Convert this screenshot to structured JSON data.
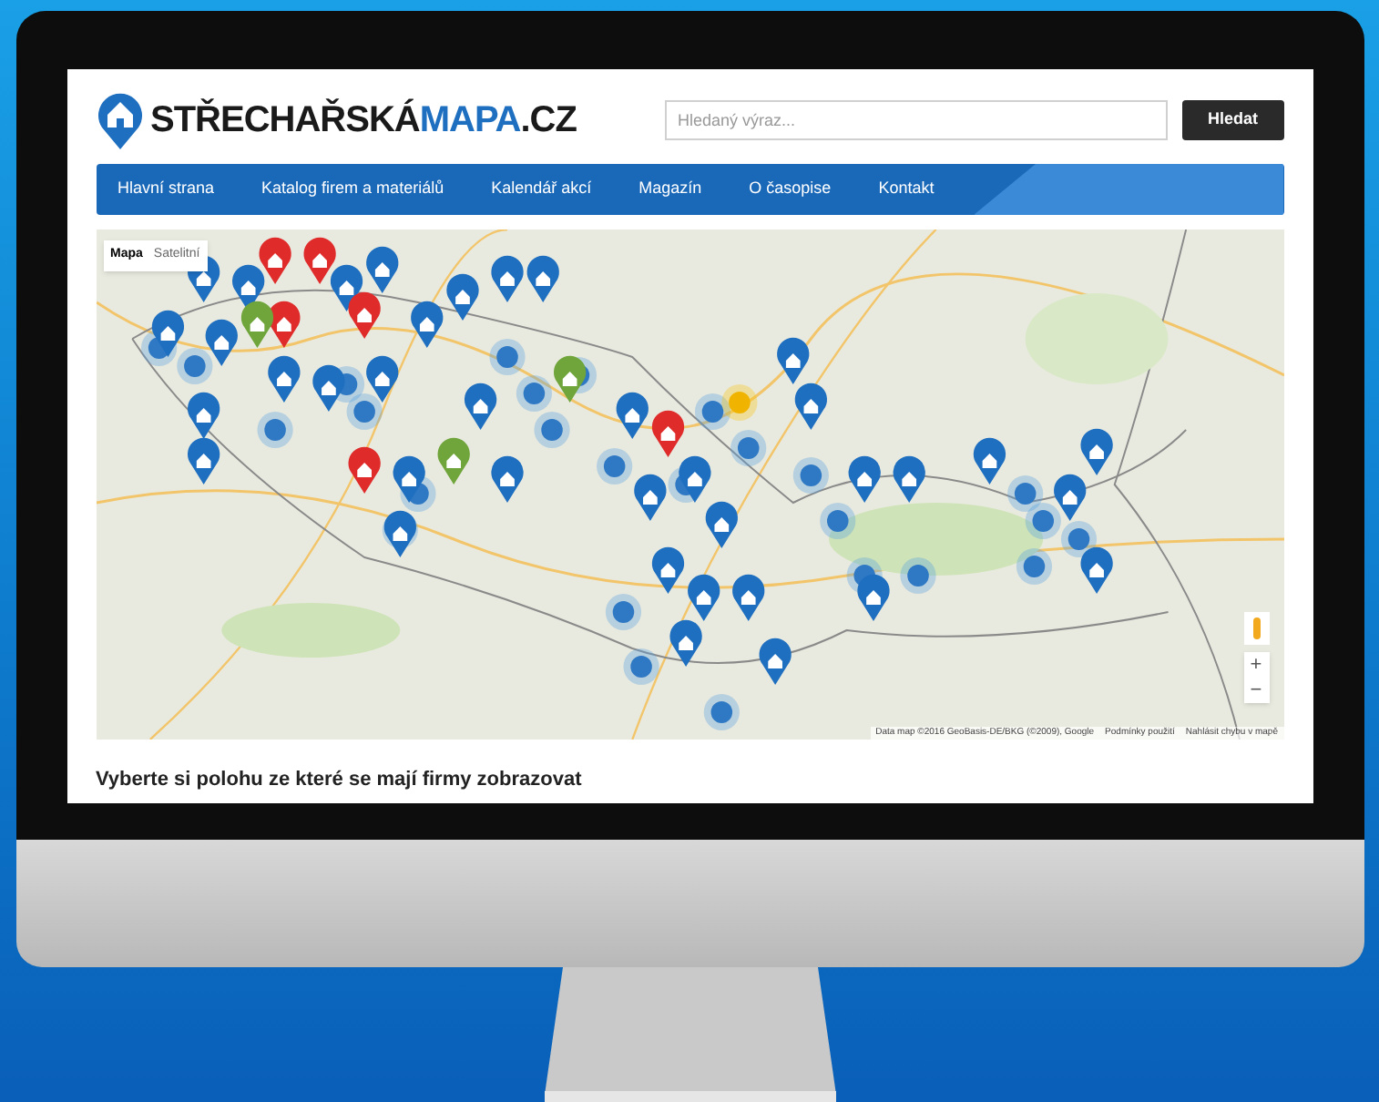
{
  "logo": {
    "parts": [
      {
        "text": "STŘECHAŘSKÁ",
        "kind": "dark"
      },
      {
        "text": "MAPA",
        "kind": "accent"
      },
      {
        "text": ".CZ",
        "kind": "dark"
      }
    ]
  },
  "search": {
    "placeholder": "Hledaný výraz...",
    "button": "Hledat"
  },
  "nav": [
    "Hlavní strana",
    "Katalog firem a materiálů",
    "Kalendář akcí",
    "Magazín",
    "O časopise",
    "Kontakt"
  ],
  "map": {
    "type_toggle": [
      {
        "label": "Mapa",
        "selected": true
      },
      {
        "label": "Satelitní",
        "selected": false
      }
    ],
    "zoom_in": "+",
    "zoom_out": "−",
    "attribution": "Data map ©2016 GeoBasis-DE/BKG (©2009), Google",
    "terms": "Podmínky použití",
    "report": "Nahlásit chybu v mapě"
  },
  "heading": "Vyberte si polohu ze které se mají firmy zobrazovat"
}
